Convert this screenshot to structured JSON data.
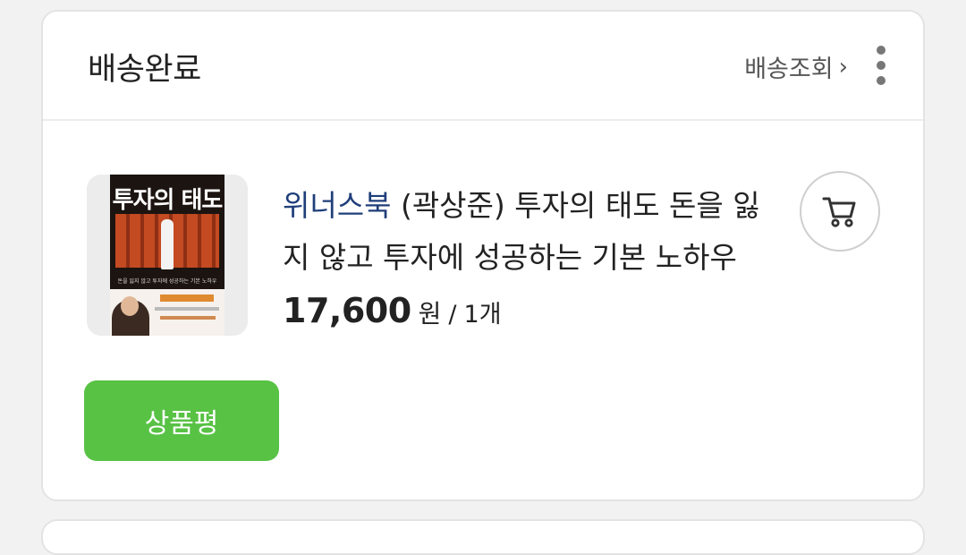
{
  "order_card": {
    "status_title": "배송완료",
    "track_label": "배송조회",
    "track_chevron": "›",
    "more_icon": "more-vertical-icon"
  },
  "product": {
    "brand": "위너스북",
    "name": " (곽상준) 투자의 태도 돈을 잃지 않고 투자에 성공하는 기본 노하우",
    "price": "17,600",
    "currency": "원",
    "separator": "/",
    "quantity": "1개",
    "thumbnail": {
      "cover_title": "투자의 태도",
      "cover_subtitle": "돈을 잃지 않고 투자에 성공하는 기본 노하우"
    },
    "cart_icon": "cart-icon"
  },
  "actions": {
    "review_label": "상품평"
  },
  "colors": {
    "accent_green": "#58c245",
    "brand_blue": "#1f3f7a"
  }
}
